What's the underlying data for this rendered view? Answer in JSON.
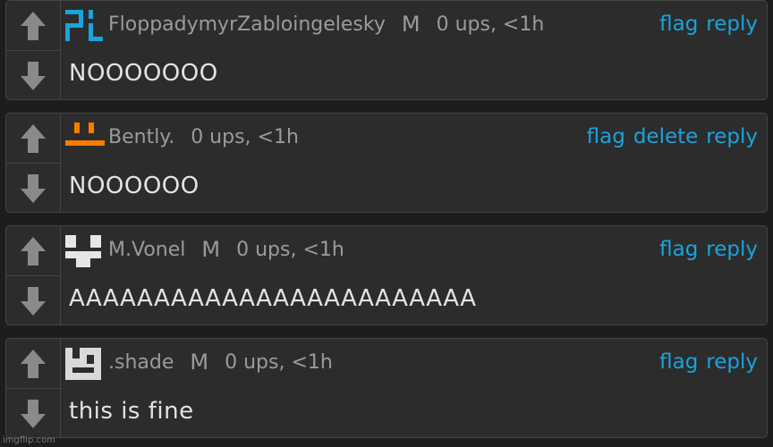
{
  "comments": [
    {
      "username": "FloppadymyrZabloingelesky",
      "mod_badge": "M",
      "stats": "0 ups, <1h",
      "text": "NOOOOOOO",
      "actions": {
        "flag": "flag",
        "reply": "reply"
      },
      "avatar": {
        "name": "blue-pixel-avatar",
        "color": "#1aa3dc"
      }
    },
    {
      "username": "Bently.",
      "mod_badge": "",
      "stats": "0 ups, <1h",
      "text": "NOOOOOO",
      "actions": {
        "flag": "flag",
        "delete": "delete",
        "reply": "reply"
      },
      "avatar": {
        "name": "orange-face-avatar",
        "color": "#ff7a00"
      }
    },
    {
      "username": "M.Vonel",
      "mod_badge": "M",
      "stats": "0 ups, <1h",
      "text": "AAAAAAAAAAAAAAAAAAAAAAAA",
      "actions": {
        "flag": "flag",
        "reply": "reply"
      },
      "avatar": {
        "name": "white-face-avatar",
        "color": "#e6e6e6"
      }
    },
    {
      "username": ".shade",
      "mod_badge": "M",
      "stats": "0 ups, <1h",
      "text": "this is fine",
      "actions": {
        "flag": "flag",
        "reply": "reply"
      },
      "avatar": {
        "name": "white-box-avatar",
        "color": "#d9d9d9"
      }
    }
  ],
  "icons": {
    "upvote": "arrow-up-icon",
    "downvote": "arrow-down-icon"
  },
  "colors": {
    "background": "#1d1d1d",
    "card": "#2c2c2c",
    "link": "#1aa3dc",
    "meta": "#9b9b9b",
    "text": "#e3e3e3"
  },
  "watermark": "imgflip.com"
}
